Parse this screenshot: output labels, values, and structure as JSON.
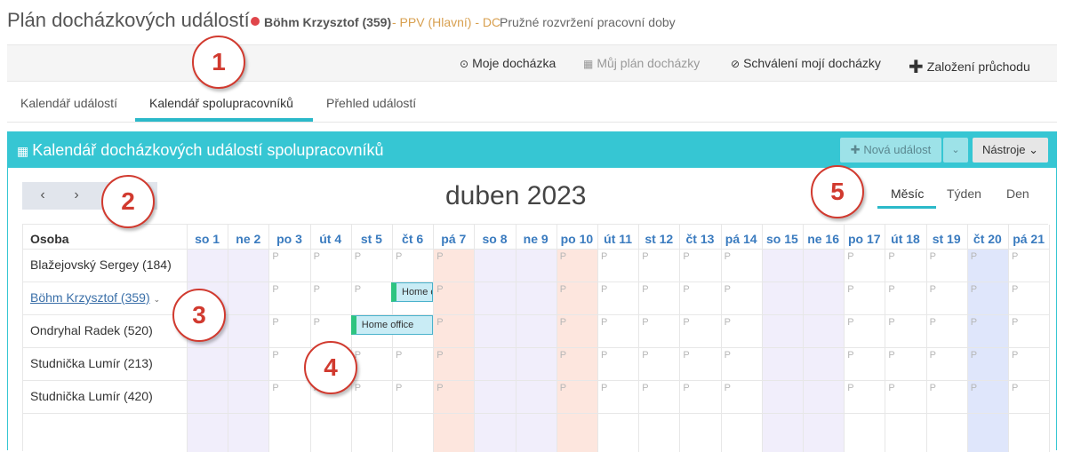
{
  "header": {
    "title": "Plán docházkových událostí",
    "user_name": "Böhm Krzysztof (359)",
    "org": "- PPV (Hlavní) - DC",
    "schedule": "Pružné rozvržení pracovní doby"
  },
  "actions": {
    "my_attendance": "Moje docházka",
    "my_plan": "Můj plán docházky",
    "approval": "Schválení mojí docházky",
    "create_pass": "Založení průchodu"
  },
  "tabs": [
    "Kalendář událostí",
    "Kalendář spolupracovníků",
    "Přehled událostí"
  ],
  "active_tab": 1,
  "panel": {
    "title": "Kalendář docházkových událostí spolupracovníků",
    "new_event": "Nová událost",
    "tools": "Nástroje"
  },
  "calendar": {
    "month_title": "duben 2023",
    "views": [
      "Měsíc",
      "Týden",
      "Den"
    ],
    "active_view": "Měsíc",
    "person_header": "Osoba",
    "persons": [
      "Blažejovský Sergey (184)",
      "Böhm Krzysztof (359)",
      "Ondryhal Radek (520)",
      "Studnička Lumír (213)",
      "Studnička Lumír (420)"
    ],
    "days": [
      "so 1",
      "ne 2",
      "po 3",
      "út 4",
      "st 5",
      "čt 6",
      "pá 7",
      "so 8",
      "ne 9",
      "po 10",
      "út 11",
      "st 12",
      "čt 13",
      "pá 14",
      "so 15",
      "ne 16",
      "po 17",
      "út 18",
      "st 19",
      "čt 20",
      "pá 21"
    ],
    "planned_mark": "P",
    "events": [
      {
        "person": 1,
        "label": "Home office"
      },
      {
        "person": 2,
        "label": "Home office"
      }
    ]
  },
  "annotations": [
    "1",
    "2",
    "3",
    "4",
    "5"
  ],
  "colors": {
    "accent": "#36c6d3",
    "weekend": "#f1eefb",
    "holiday": "#fde6de",
    "today": "#dfe6fb",
    "event_bar": "#2ec480",
    "callout": "#d13a2f"
  }
}
